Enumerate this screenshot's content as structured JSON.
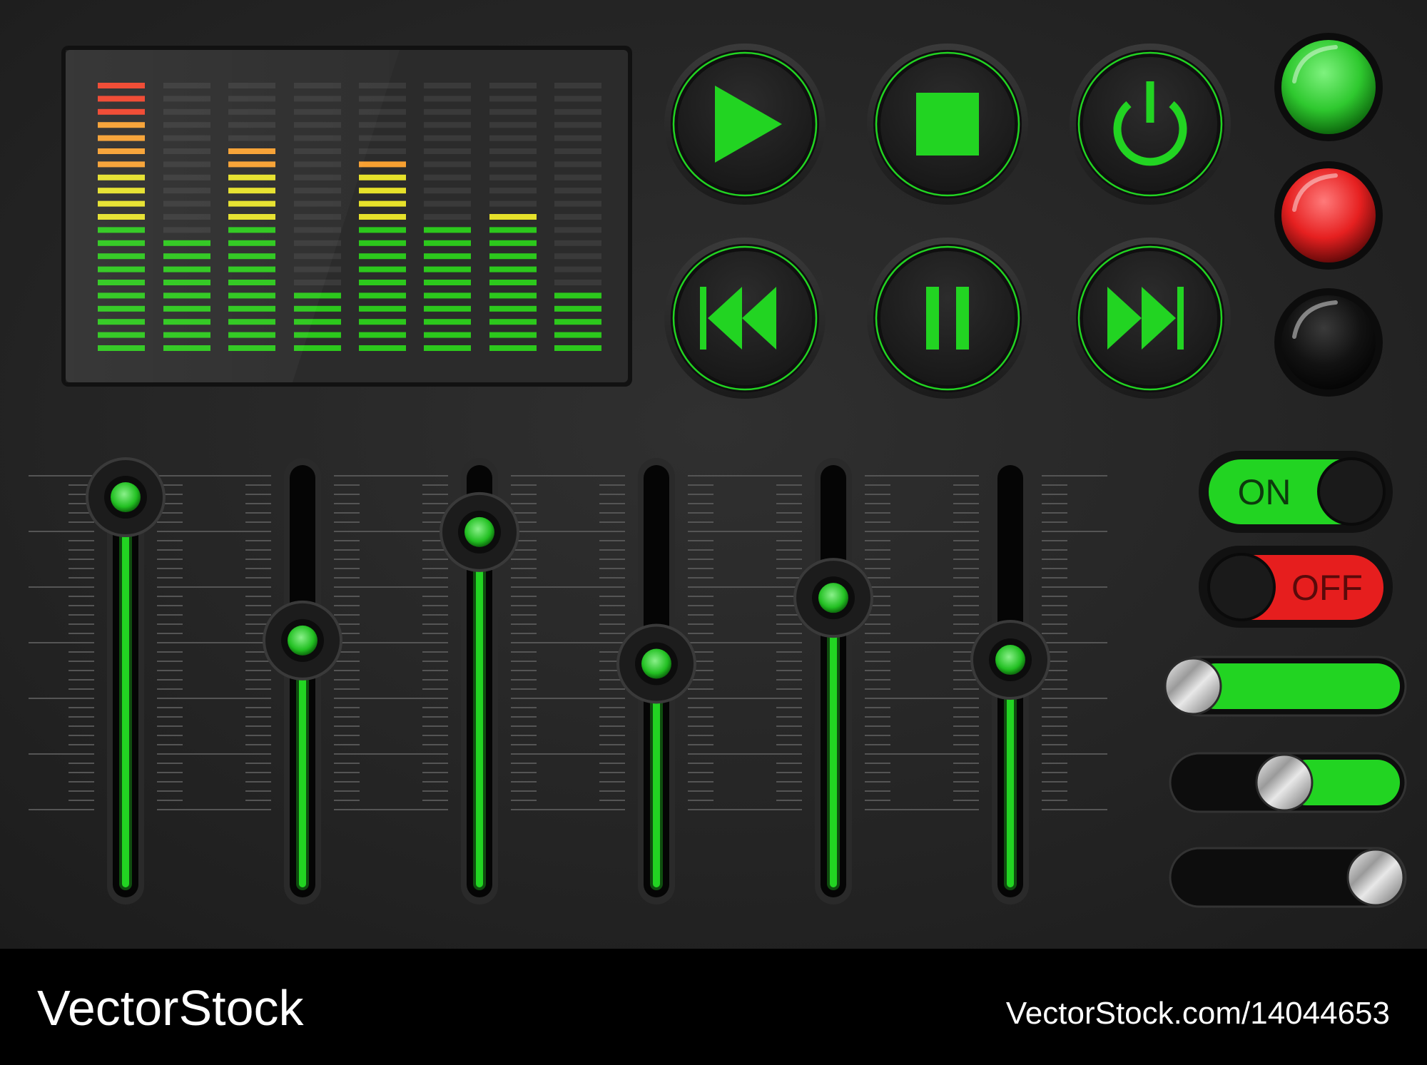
{
  "colors": {
    "panel": "#262626",
    "accent_green": "#22d422",
    "accent_red": "#e61e1e",
    "bar_red": "#f0442c",
    "bar_orange": "#f7a031",
    "bar_yellow": "#e6e12a",
    "bar_green": "#2cc81c",
    "unlit_segment": "#3a3a3a"
  },
  "equalizer": {
    "segments_per_column": 21,
    "levels": [
      21,
      9,
      16,
      5,
      15,
      10,
      11,
      5
    ]
  },
  "transport": [
    {
      "name": "play-button",
      "icon": "play-icon"
    },
    {
      "name": "stop-button",
      "icon": "stop-icon"
    },
    {
      "name": "power-button",
      "icon": "power-icon"
    },
    {
      "name": "previous-button",
      "icon": "previous-icon"
    },
    {
      "name": "pause-button",
      "icon": "pause-icon"
    },
    {
      "name": "next-button",
      "icon": "next-icon"
    }
  ],
  "indicator_lamps": [
    {
      "name": "indicator-lamp-green",
      "state": "on",
      "color": "#3ad43a"
    },
    {
      "name": "indicator-lamp-red",
      "state": "on",
      "color": "#e62a2a"
    },
    {
      "name": "indicator-lamp-off",
      "state": "off",
      "color": "#141414"
    }
  ],
  "faders": {
    "levels": [
      1.0,
      0.63,
      0.91,
      0.57,
      0.74,
      0.58
    ]
  },
  "toggles": [
    {
      "label": "ON",
      "state": "on"
    },
    {
      "label": "OFF",
      "state": "off"
    }
  ],
  "switches": {
    "levels": [
      1.0,
      0.5,
      0.0
    ]
  },
  "footer": {
    "brand": "VectorStock",
    "url": "VectorStock.com/14044653"
  }
}
